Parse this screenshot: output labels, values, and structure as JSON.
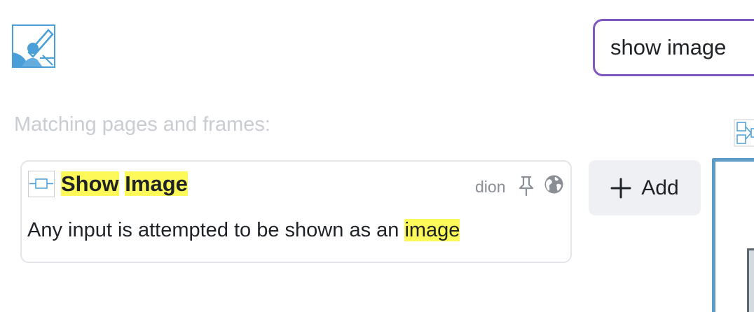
{
  "header": {
    "logo_icon": "pencil-brush-logo-icon"
  },
  "search": {
    "value": "show image"
  },
  "results": {
    "heading": "Matching pages and frames:",
    "items": [
      {
        "type_icon": "frame-icon",
        "title_parts": {
          "first": "Show",
          "second": "Image"
        },
        "author": "dion",
        "pin_icon": "pin-icon",
        "visibility_icon": "globe-icon",
        "description_prefix": "Any input is attempted to be shown as an ",
        "description_highlight": "image"
      }
    ]
  },
  "add_button": {
    "label": "Add",
    "icon": "plus-icon"
  },
  "colors": {
    "accent": "#7e57c2",
    "highlight": "#fcf959",
    "logo": "#4a9fd8",
    "preview_border": "#5b9bc6",
    "button_bg": "#eef0f4",
    "muted_text": "#c9cdd2"
  }
}
